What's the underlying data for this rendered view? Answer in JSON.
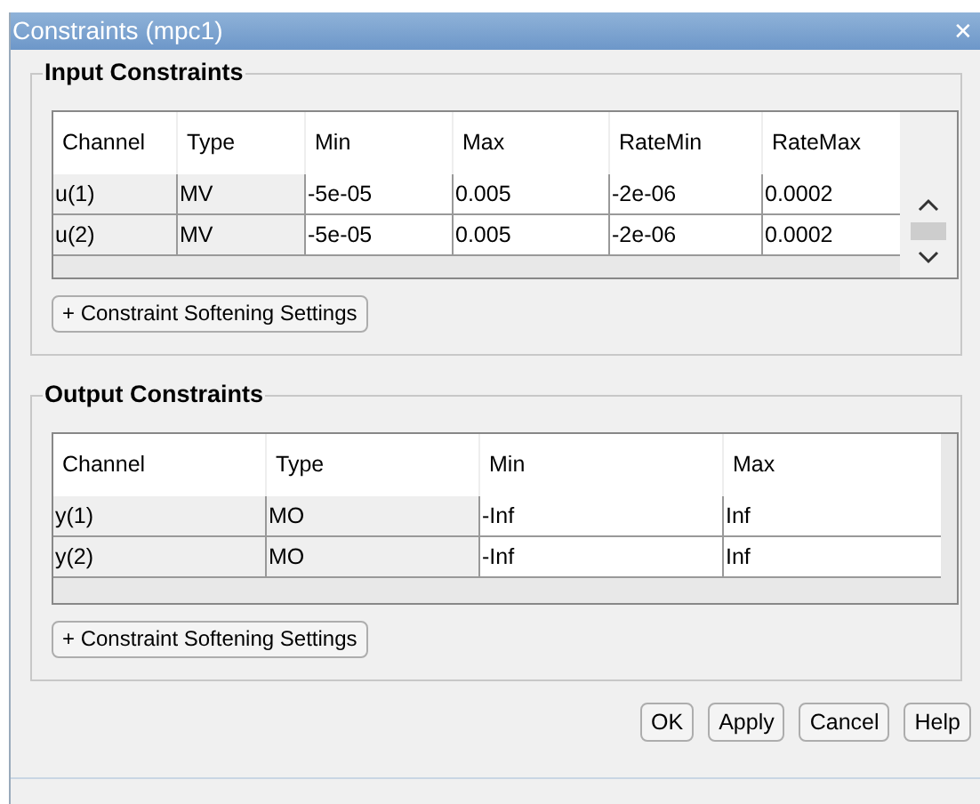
{
  "window": {
    "title": "Constraints (mpc1)",
    "close": "✕"
  },
  "panels": [
    {
      "title": "Input Constraints",
      "columns": [
        "Channel",
        "Type",
        "Min",
        "Max",
        "RateMin",
        "RateMax"
      ],
      "scrollbar": true,
      "rows": [
        [
          "u(1)",
          "MV",
          "-5e-05",
          "0.005",
          "-2e-06",
          "0.0002"
        ],
        [
          "u(2)",
          "MV",
          "-5e-05",
          "0.005",
          "-2e-06",
          "0.0002"
        ]
      ],
      "button": "+ Constraint Softening Settings"
    },
    {
      "title": "Output Constraints",
      "columns": [
        "Channel",
        "Type",
        "Min",
        "Max"
      ],
      "scrollbar": false,
      "rows": [
        [
          "y(1)",
          "MO",
          "-Inf",
          "Inf"
        ],
        [
          "y(2)",
          "MO",
          "-Inf",
          "Inf"
        ]
      ],
      "button": "+ Constraint Softening Settings"
    }
  ],
  "buttons": [
    "OK",
    "Apply",
    "Cancel",
    "Help"
  ]
}
